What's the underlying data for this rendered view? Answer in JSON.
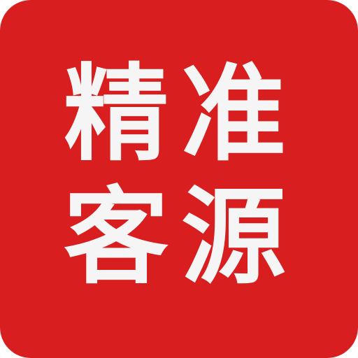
{
  "icon": {
    "background_color": "#d81e1e",
    "text_color": "#f5f5f5",
    "row1": [
      "精",
      "准"
    ],
    "row2": [
      "客",
      "源"
    ]
  }
}
